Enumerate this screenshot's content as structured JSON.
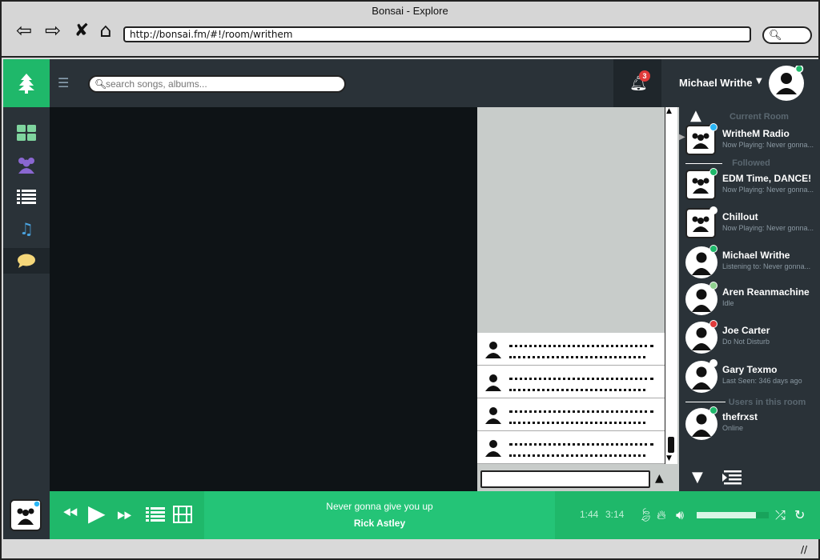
{
  "browser": {
    "title": "Bonsai - Explore",
    "url": "http://bonsai.fm/#!/room/writhem"
  },
  "header": {
    "search_placeholder": "search songs, albums...",
    "notification_count": "3",
    "user_name": "Michael Writhe"
  },
  "rooms_panel": {
    "current_room_label": "Current Room",
    "followed_label": "Followed",
    "users_label": "Users in this room",
    "current_room": {
      "name": "WritheM Radio",
      "sub": "Now Playing: Never gonna...",
      "status_color": "#29b6f6"
    },
    "followed": [
      {
        "name": "EDM Time, DANCE!",
        "sub": "Now Playing: Never gonna...",
        "status_color": "#1fb86a",
        "kind": "room"
      },
      {
        "name": "Chillout",
        "sub": "Now Playing: Never gonna...",
        "status_color": "#ffffff",
        "kind": "room"
      },
      {
        "name": "Michael Writhe",
        "sub": "Listening to: Never gonna...",
        "status_color": "#1fb86a",
        "kind": "user"
      },
      {
        "name": "Aren Reanmachine",
        "sub": "Idle",
        "status_color": "#8fd18f",
        "kind": "user"
      },
      {
        "name": "Joe Carter",
        "sub": "Do Not Disturb",
        "status_color": "#e03a3a",
        "kind": "user"
      },
      {
        "name": "Gary Texmo",
        "sub": "Last Seen: 346 days ago",
        "status_color": "#ffffff",
        "kind": "user"
      }
    ],
    "room_users": [
      {
        "name": "thefrxst",
        "sub": "Online",
        "status_color": "#1fb86a"
      }
    ]
  },
  "player": {
    "title": "Never gonna give you up",
    "artist": "Rick Astley",
    "elapsed": "1:44",
    "duration": "3:14",
    "volume": 0.82
  },
  "colors": {
    "accent": "#1fb86a",
    "sidebar": "#2a3238"
  }
}
